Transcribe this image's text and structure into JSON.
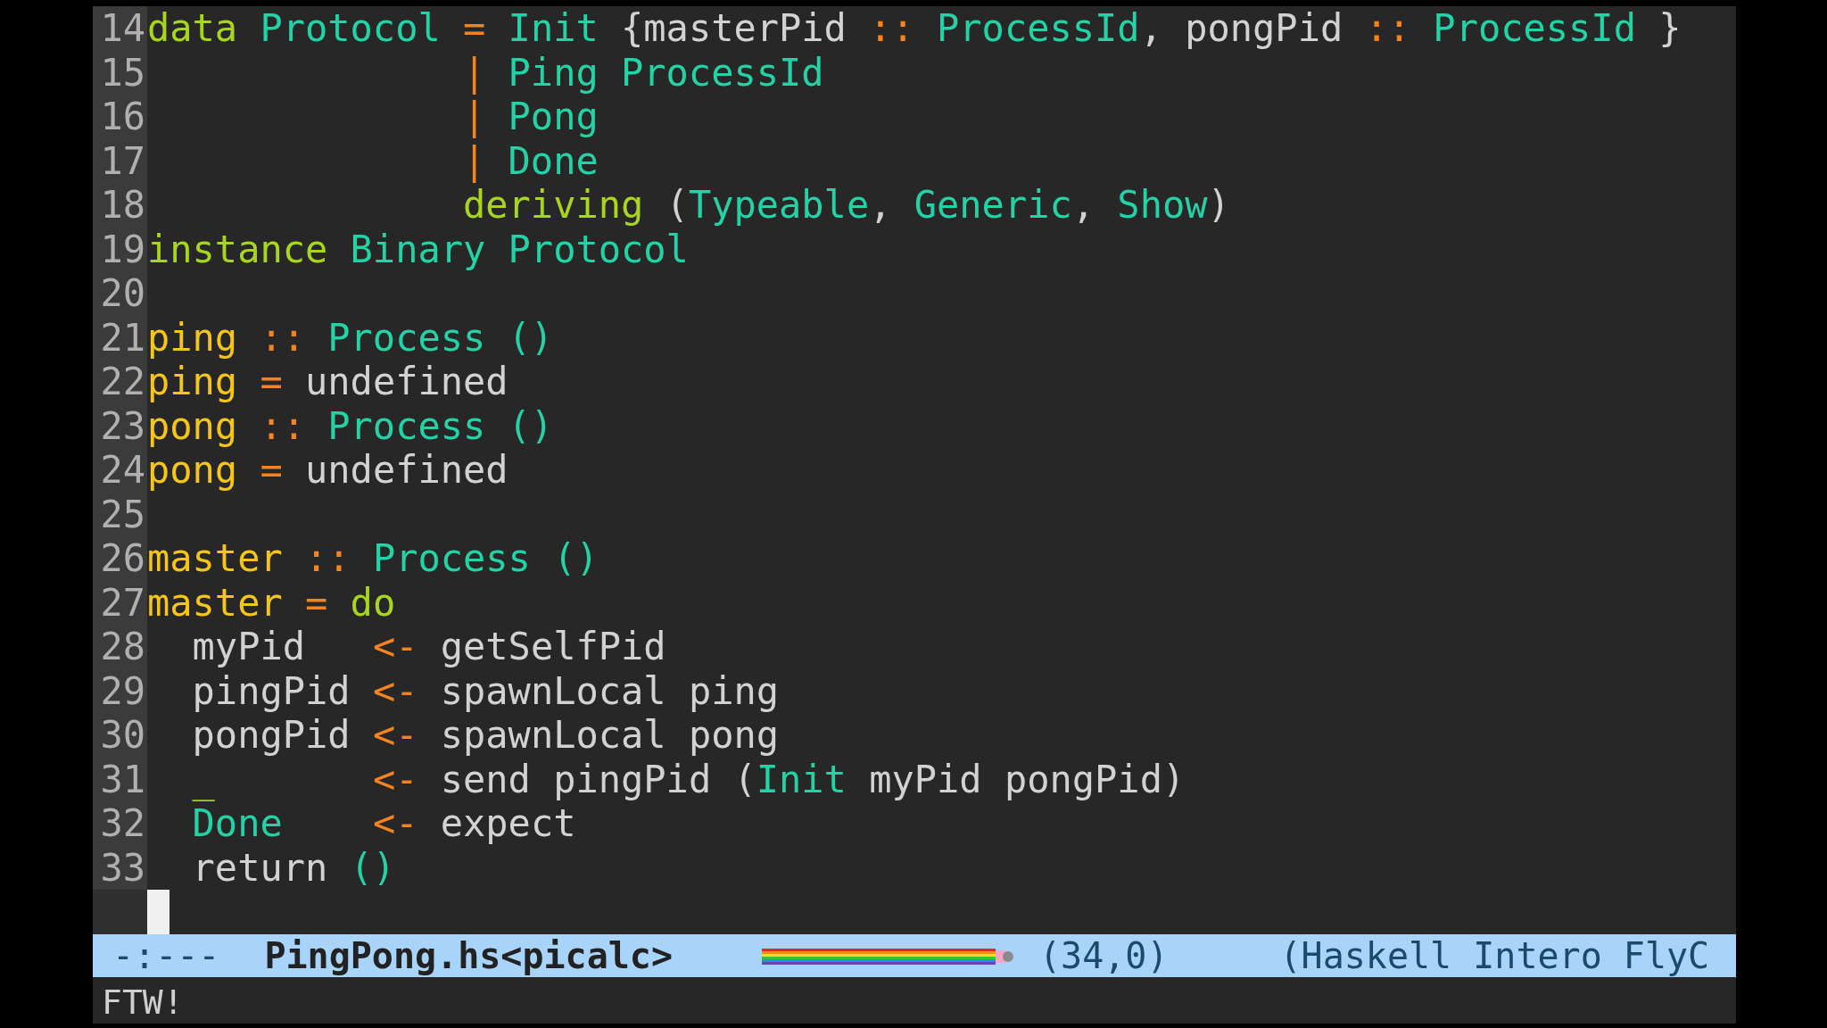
{
  "editor": {
    "lines": [
      {
        "number": "14",
        "tokens": [
          {
            "text": "data ",
            "kind": "keyword"
          },
          {
            "text": "Protocol ",
            "kind": "type"
          },
          {
            "text": "= ",
            "kind": "operator"
          },
          {
            "text": "Init",
            "kind": "type"
          },
          {
            "text": " {masterPid "
          },
          {
            "text": ":: ",
            "kind": "operator"
          },
          {
            "text": "ProcessId",
            "kind": "type"
          },
          {
            "text": ", pongPid "
          },
          {
            "text": ":: ",
            "kind": "operator"
          },
          {
            "text": "ProcessId",
            "kind": "type"
          },
          {
            "text": " }"
          }
        ]
      },
      {
        "number": "15",
        "tokens": [
          {
            "text": "              | ",
            "kind": "operator"
          },
          {
            "text": "Ping ProcessId",
            "kind": "type"
          }
        ]
      },
      {
        "number": "16",
        "tokens": [
          {
            "text": "              | ",
            "kind": "operator"
          },
          {
            "text": "Pong",
            "kind": "type"
          }
        ]
      },
      {
        "number": "17",
        "tokens": [
          {
            "text": "              | ",
            "kind": "operator"
          },
          {
            "text": "Done",
            "kind": "type"
          }
        ]
      },
      {
        "number": "18",
        "tokens": [
          {
            "text": "              deriving",
            "kind": "keyword"
          },
          {
            "text": " ("
          },
          {
            "text": "Typeable",
            "kind": "type"
          },
          {
            "text": ", "
          },
          {
            "text": "Generic",
            "kind": "type"
          },
          {
            "text": ", "
          },
          {
            "text": "Show",
            "kind": "type"
          },
          {
            "text": ")"
          }
        ]
      },
      {
        "number": "19",
        "tokens": [
          {
            "text": "instance ",
            "kind": "keyword"
          },
          {
            "text": "Binary Protocol",
            "kind": "type"
          }
        ]
      },
      {
        "number": "20"
      },
      {
        "number": "21",
        "tokens": [
          {
            "text": "ping ",
            "kind": "name"
          },
          {
            "text": ":: ",
            "kind": "operator"
          },
          {
            "text": "Process ()",
            "kind": "type"
          }
        ]
      },
      {
        "number": "22",
        "tokens": [
          {
            "text": "ping ",
            "kind": "name"
          },
          {
            "text": "=",
            "kind": "operator"
          },
          {
            "text": " undefined"
          }
        ]
      },
      {
        "number": "23",
        "tokens": [
          {
            "text": "pong ",
            "kind": "name"
          },
          {
            "text": ":: ",
            "kind": "operator"
          },
          {
            "text": "Process ()",
            "kind": "type"
          }
        ]
      },
      {
        "number": "24",
        "tokens": [
          {
            "text": "pong ",
            "kind": "name"
          },
          {
            "text": "=",
            "kind": "operator"
          },
          {
            "text": " undefined"
          }
        ]
      },
      {
        "number": "25"
      },
      {
        "number": "26",
        "tokens": [
          {
            "text": "master ",
            "kind": "name"
          },
          {
            "text": ":: ",
            "kind": "operator"
          },
          {
            "text": "Process ()",
            "kind": "type"
          }
        ]
      },
      {
        "number": "27",
        "tokens": [
          {
            "text": "master ",
            "kind": "name"
          },
          {
            "text": "= ",
            "kind": "operator"
          },
          {
            "text": "do",
            "kind": "keyword"
          }
        ]
      },
      {
        "number": "28",
        "tokens": [
          {
            "text": "  myPid   "
          },
          {
            "text": "<-",
            "kind": "operator"
          },
          {
            "text": " getSelfPid"
          }
        ]
      },
      {
        "number": "29",
        "tokens": [
          {
            "text": "  pingPid "
          },
          {
            "text": "<-",
            "kind": "operator"
          },
          {
            "text": " spawnLocal ping"
          }
        ]
      },
      {
        "number": "30",
        "tokens": [
          {
            "text": "  pongPid "
          },
          {
            "text": "<-",
            "kind": "operator"
          },
          {
            "text": " spawnLocal pong"
          }
        ]
      },
      {
        "number": "31",
        "tokens": [
          {
            "text": "  _       ",
            "kind": "keyword"
          },
          {
            "text": "<-",
            "kind": "operator"
          },
          {
            "text": " send pingPid ("
          },
          {
            "text": "Init",
            "kind": "type"
          },
          {
            "text": " myPid pongPid)"
          }
        ]
      },
      {
        "number": "32",
        "tokens": [
          {
            "text": "  Done    ",
            "kind": "type"
          },
          {
            "text": "<-",
            "kind": "operator"
          },
          {
            "text": " expect"
          }
        ]
      },
      {
        "number": "33",
        "tokens": [
          {
            "text": "  return "
          },
          {
            "text": "()",
            "kind": "type"
          }
        ]
      }
    ]
  },
  "mode_line": {
    "status": "-:---",
    "buffer": "PingPong.hs<picalc>",
    "position": "(34,0)",
    "modes": "(Haskell Intero FlyC"
  },
  "minibuffer": "FTW!"
}
